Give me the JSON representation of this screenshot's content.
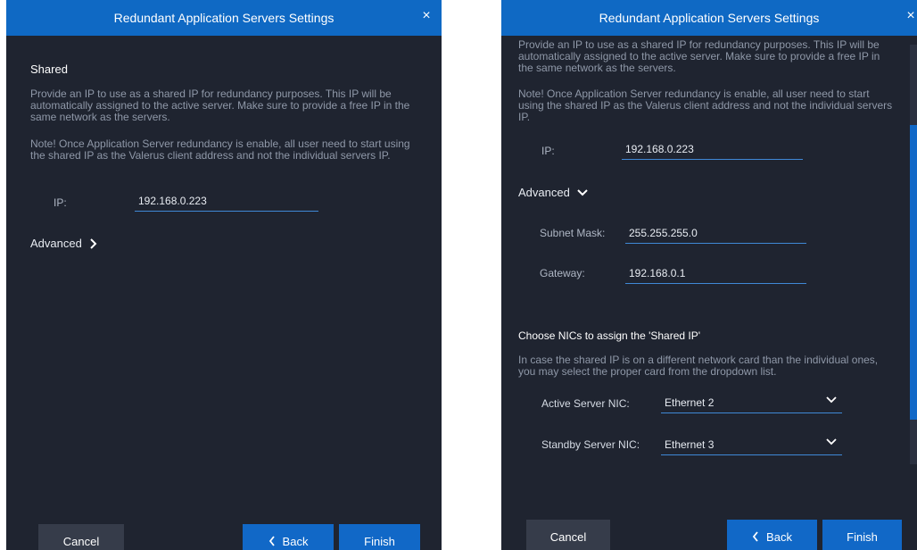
{
  "title": "Redundant Application Servers Settings",
  "close_glyph": "×",
  "left": {
    "section_title": "Shared",
    "description": "Provide an IP to use as a shared IP for redundancy purposes. This IP will be automatically assigned to the active server. Make sure to provide a free IP in the same network as the servers.",
    "note": "Note! Once Application Server redundancy is enable, all user need to start using the shared IP as the Valerus client address and not the individual servers IP.",
    "ip_label": "IP:",
    "ip_value": "192.168.0.223",
    "advanced_label": "Advanced"
  },
  "right": {
    "description": "Provide an IP to use as a shared IP for redundancy purposes. This IP will be automatically assigned to the active server. Make sure to provide a free IP in the same network as the servers.",
    "note": "Note! Once Application Server redundancy is enable, all user need to start using the shared IP as the Valerus client address and not the individual servers IP.",
    "ip_label": "IP:",
    "ip_value": "192.168.0.223",
    "advanced_label": "Advanced",
    "subnet_label": "Subnet Mask:",
    "subnet_value": "255.255.255.0",
    "gateway_label": "Gateway:",
    "gateway_value": "192.168.0.1",
    "nic_title": "Choose NICs to assign the 'Shared IP'",
    "nic_description": "In case the shared IP is on a different network card than the individual ones, you may select the proper card from the dropdown list.",
    "active_nic_label": "Active Server NIC:",
    "active_nic_value": "Ethernet 2",
    "standby_nic_label": "Standby Server NIC:",
    "standby_nic_value": "Ethernet 3"
  },
  "buttons": {
    "cancel": "Cancel",
    "back": "Back",
    "finish": "Finish"
  },
  "colors": {
    "dialog_bg": "#1f2430",
    "titlebar": "#0f69c4",
    "primary_button": "#1168c7",
    "secondary_button": "#363c4a",
    "underline": "#3f88d6"
  },
  "icons": {
    "close": "close-icon",
    "advanced_collapsed": "chevron-right-icon",
    "advanced_expanded": "chevron-down-icon",
    "back": "chevron-left-icon",
    "dropdown": "chevron-down-icon"
  }
}
